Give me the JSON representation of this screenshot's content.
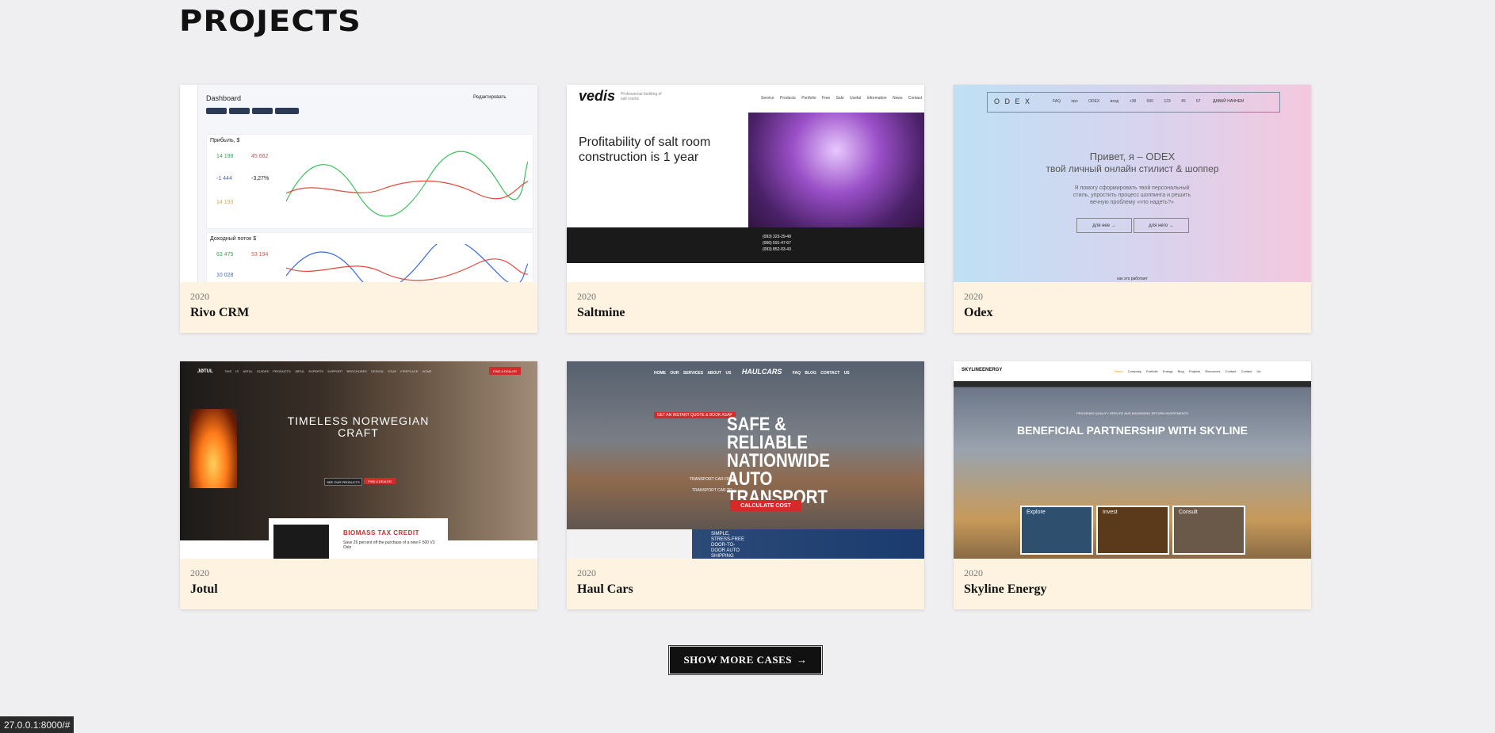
{
  "page": {
    "title": "PROJECTS"
  },
  "cards": [
    {
      "year": "2020",
      "name": "Rivo CRM",
      "thumb": {
        "heading": "Dashboard",
        "edit_link": "Редактировать",
        "section1": "Прибыль, $",
        "kpis": [
          "14 198",
          "45 662",
          "-1 444",
          "-3,27%",
          "14 193"
        ],
        "section2": "Доходный поток $",
        "kpis2": [
          "63 475",
          "53 194",
          "10 028"
        ]
      }
    },
    {
      "year": "2020",
      "name": "Saltmine",
      "thumb": {
        "logo": "vedis",
        "tagline": "Professional building of salt rooms",
        "nav": [
          "Service Products",
          "Portfolio",
          "Free Sale",
          "Useful Information",
          "News",
          "Contact"
        ],
        "headline": "Profitability of salt room construction is 1 year",
        "phones": [
          "(093) 323-29-49",
          "(066) 591-47-67",
          "(093) 852-03-43"
        ]
      }
    },
    {
      "year": "2020",
      "name": "Odex",
      "thumb": {
        "logo": "O D E X",
        "nav": [
          "FAQ",
          "про ODEX",
          "вход",
          "+38 000 123 45 67"
        ],
        "cta": "ДАВАЙ НАЧНЕМ",
        "headline1": "Привет, я – ODEX",
        "headline2": "твой личный онлайн стилист & шоппер",
        "body": "Я помогу сформировать твой персональный стиль, упростить процесс шоппинга и решить вечную проблему «что надеть?»",
        "btn1": "для нее  →",
        "btn2": "для него  →",
        "footer": "как это работает"
      }
    },
    {
      "year": "2020",
      "name": "Jotul",
      "thumb": {
        "logo": "JØTUL",
        "nav": [
          "THIS IS JØTUL",
          "GUIDES",
          "PRODUCTS",
          "JØTUL EXPERTS",
          "SUPPORT",
          "BROCHURES",
          "DESIGN YOUR FIREPLACE HOME"
        ],
        "dealer": "FIND A DEALER",
        "headline": "TIMELESS NORWEGIAN CRAFT",
        "btn1": "SEE OUR PRODUCTS",
        "btn2": "FIND A DEALER",
        "promo_title": "BIOMASS TAX CREDIT",
        "promo_body": "Save 26 percent off the purchase of a new F 500 V3 Oslo"
      }
    },
    {
      "year": "2020",
      "name": "Haul Cars",
      "thumb": {
        "nav": [
          "HOME",
          "OUR SERVICES",
          "ABOUT US",
          "FAQ",
          "BLOG",
          "CONTACT US"
        ],
        "logo": "HAULCARS",
        "badge": "GET AN INSTANT QUOTE & BOOK ASAP",
        "headline": "SAFE & RELIABLE NATIONWIDE AUTO TRANSPORT",
        "field1": "TRANSPORT CAR FROM",
        "field2": "TRANSPORT CAR TO",
        "cta": "CALCULATE COST",
        "promo": "SIMPLE, STRESS-FREE DOOR-TO-DOOR AUTO SHIPPING"
      }
    },
    {
      "year": "2020",
      "name": "Skyline Energy",
      "thumb": {
        "logo": "SKYLINEENERGY",
        "nav": [
          "Home",
          "Company",
          "Portfolio",
          "Energy",
          "Blog",
          "Projects",
          "Resources",
          "Contact",
          "Contact Us"
        ],
        "eyebrow": "PROVIDING QUALITY SERVICE AND MAXIMIZING RETURN INVESTMENTS",
        "headline": "BENEFICIAL PARTNERSHIP WITH SKYLINE",
        "tiles": [
          "Explore",
          "Invest",
          "Consult"
        ]
      }
    }
  ],
  "show_more": {
    "label": "SHOW MORE CASES",
    "arrow": "→"
  },
  "status_bar": {
    "url": "27.0.0.1:8000/#"
  },
  "colors": {
    "card_bg": "#fdf3e0",
    "page_bg": "#efeff1",
    "button_bg": "#111111"
  }
}
